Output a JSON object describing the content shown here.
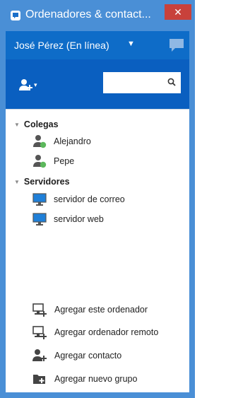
{
  "window": {
    "title": "Ordenadores & contact...",
    "close_label": "✕"
  },
  "userbar": {
    "user_name": "José Pérez (En línea)",
    "caret": "▼"
  },
  "toolbar": {
    "add_caret": "▾",
    "search_placeholder": ""
  },
  "groups": [
    {
      "name": "Colegas",
      "items": [
        {
          "label": "Alejandro",
          "icon": "contact-online-icon"
        },
        {
          "label": "Pepe",
          "icon": "contact-online-icon"
        }
      ]
    },
    {
      "name": "Servidores",
      "items": [
        {
          "label": "servidor de correo",
          "icon": "computer-icon"
        },
        {
          "label": "servidor web",
          "icon": "computer-icon"
        }
      ]
    }
  ],
  "actions": [
    {
      "label": "Agregar este ordenador",
      "icon": "add-computer-icon"
    },
    {
      "label": "Agregar ordenador remoto",
      "icon": "add-remote-computer-icon"
    },
    {
      "label": "Agregar contacto",
      "icon": "add-contact-icon"
    },
    {
      "label": "Agregar nuevo grupo",
      "icon": "add-group-icon"
    }
  ],
  "colors": {
    "frame": "#4a8fd6",
    "userbar": "#0e6cc8",
    "toolbar": "#0a5fc0",
    "close": "#c8413b",
    "online": "#5cb85c"
  }
}
